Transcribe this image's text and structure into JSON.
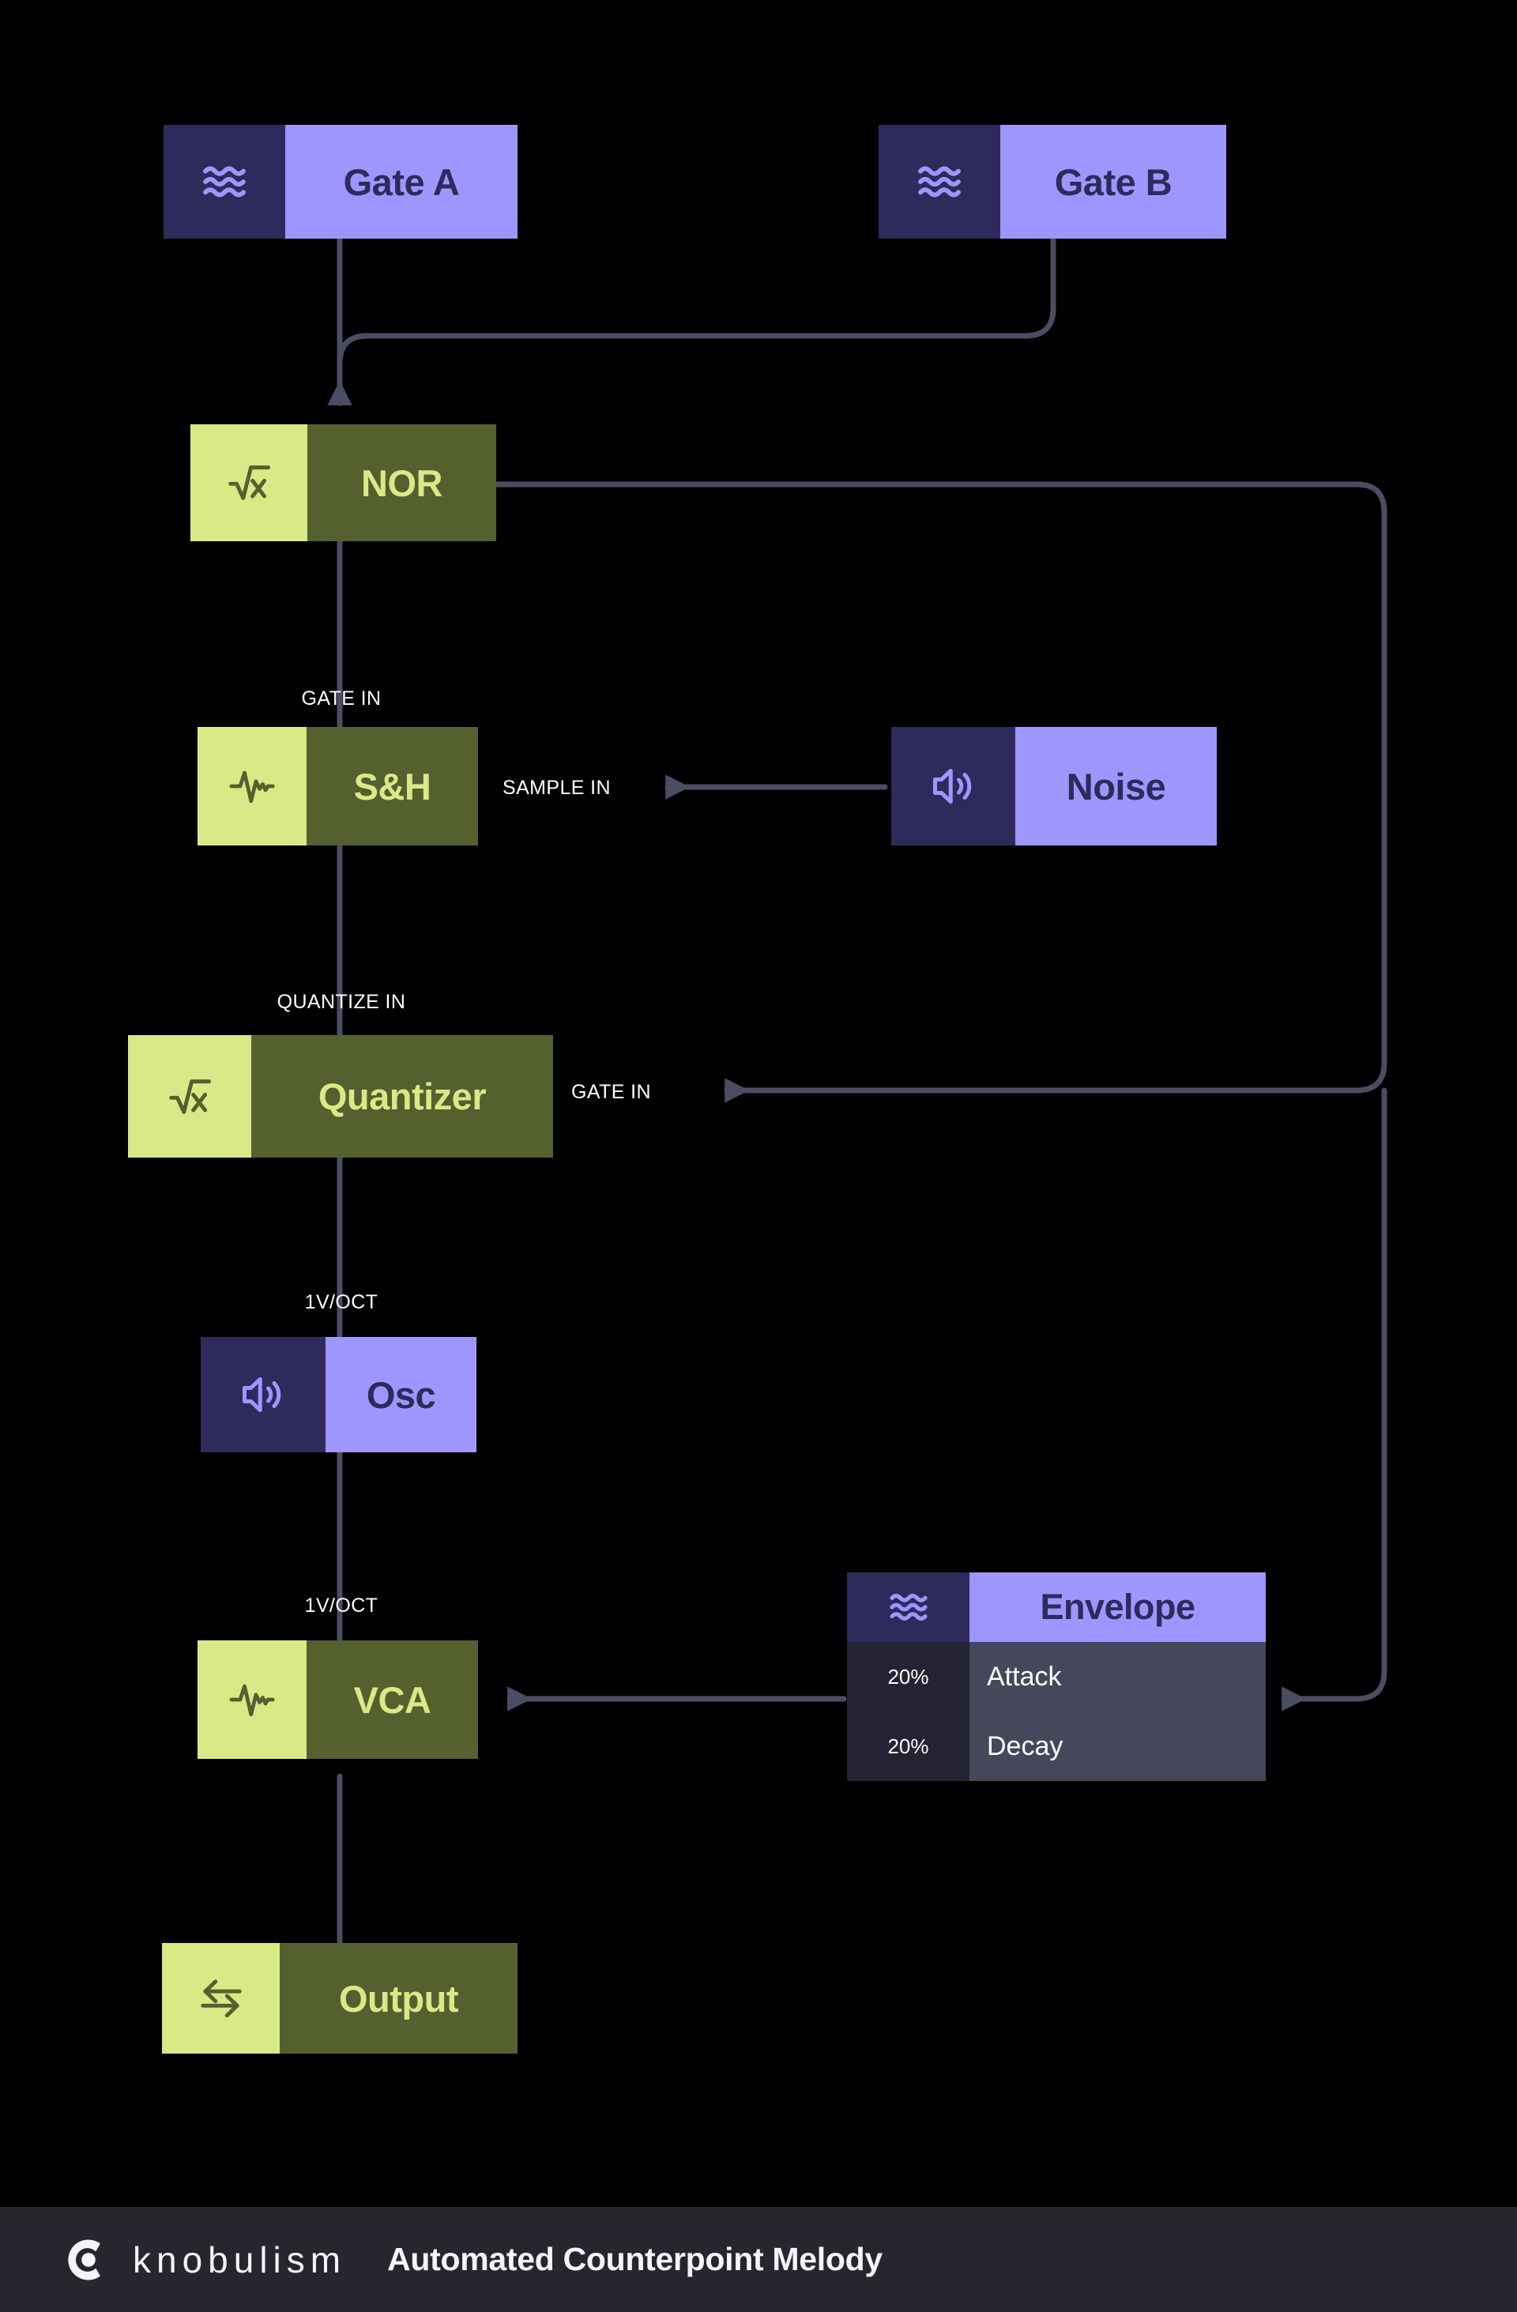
{
  "canvas": {
    "background": "#000000",
    "edge_color": "#4b4d63",
    "purple_icon_bg": "#2e2a5c",
    "purple_label_bg": "#9d97fd",
    "purple_text": "#2e2a5c",
    "olive_icon_bg": "#d7ea86",
    "olive_label_bg": "#55602f",
    "olive_text": "#d7ea86"
  },
  "nodes": [
    {
      "id": "gate_a",
      "label": "Gate A",
      "icon": "waves-icon",
      "style": "purple"
    },
    {
      "id": "gate_b",
      "label": "Gate B",
      "icon": "waves-icon",
      "style": "purple"
    },
    {
      "id": "nor",
      "label": "NOR",
      "icon": "sqrt-icon",
      "style": "olive"
    },
    {
      "id": "sh",
      "label": "S&H",
      "icon": "activity-icon",
      "style": "olive"
    },
    {
      "id": "noise",
      "label": "Noise",
      "icon": "speaker-icon",
      "style": "purple"
    },
    {
      "id": "quantizer",
      "label": "Quantizer",
      "icon": "sqrt-icon",
      "style": "olive"
    },
    {
      "id": "osc",
      "label": "Osc",
      "icon": "speaker-icon",
      "style": "purple"
    },
    {
      "id": "vca",
      "label": "VCA",
      "icon": "activity-icon",
      "style": "olive"
    },
    {
      "id": "output",
      "label": "Output",
      "icon": "transfer-icon",
      "style": "olive"
    }
  ],
  "envelope": {
    "label": "Envelope",
    "icon": "waves-icon",
    "style": "purple",
    "params": [
      {
        "value": "20%",
        "name": "Attack"
      },
      {
        "value": "20%",
        "name": "Decay"
      }
    ]
  },
  "edge_labels": {
    "gate_in_sh": "GATE IN",
    "sample_in": "SAMPLE IN",
    "quantize_in": "QUANTIZE IN",
    "gate_in_quantizer": "GATE IN",
    "one_v_oct_osc": "1V/OCT",
    "one_v_oct_vca": "1V/OCT"
  },
  "footer": {
    "logo": "knobulism-logo-icon",
    "brand": "knobulism",
    "title": "Automated Counterpoint Melody"
  }
}
